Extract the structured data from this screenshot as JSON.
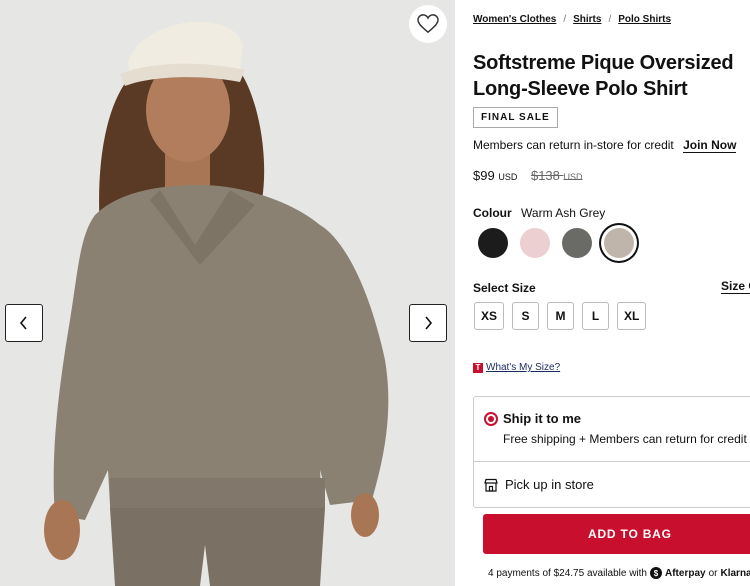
{
  "product": {
    "title_line1": "Softstreme Pique Oversized",
    "title_line2": "Long-Sleeve Polo Shirt",
    "badge": "FINAL SALE",
    "wishlist_icon": "heart-icon"
  },
  "breadcrumb": {
    "items": [
      "Women's Clothes",
      "Shirts",
      "Polo Shirts"
    ],
    "separator": "/"
  },
  "membership": {
    "text": "Members can return in-store for credit",
    "link": "Join Now"
  },
  "price": {
    "current": "$99",
    "current_currency": "USD",
    "original": "$138",
    "original_currency": "USD"
  },
  "colour": {
    "label": "Colour",
    "selected": "Warm Ash Grey",
    "swatches": [
      "#1c1c1c",
      "#ebcfd1",
      "#6a6b66",
      "#bfb5aa"
    ]
  },
  "size": {
    "label": "Select Size",
    "guide": "Size G",
    "options": [
      "XS",
      "S",
      "M",
      "L",
      "XL"
    ],
    "whats_my_size_badge": "T",
    "whats_my_size": "What's My Size?"
  },
  "fulfillment": {
    "ship_title": "Ship it to me",
    "ship_sub": "Free shipping + Members can return for credit",
    "pickup": "Pick up in store"
  },
  "cta": {
    "add_to_bag": "ADD TO BAG"
  },
  "payment": {
    "text": "4 payments of $24.75 available with",
    "afterpay": "Afterpay",
    "or": "or",
    "klarna": "Klarna."
  },
  "colors": {
    "accent": "#c8102e"
  }
}
